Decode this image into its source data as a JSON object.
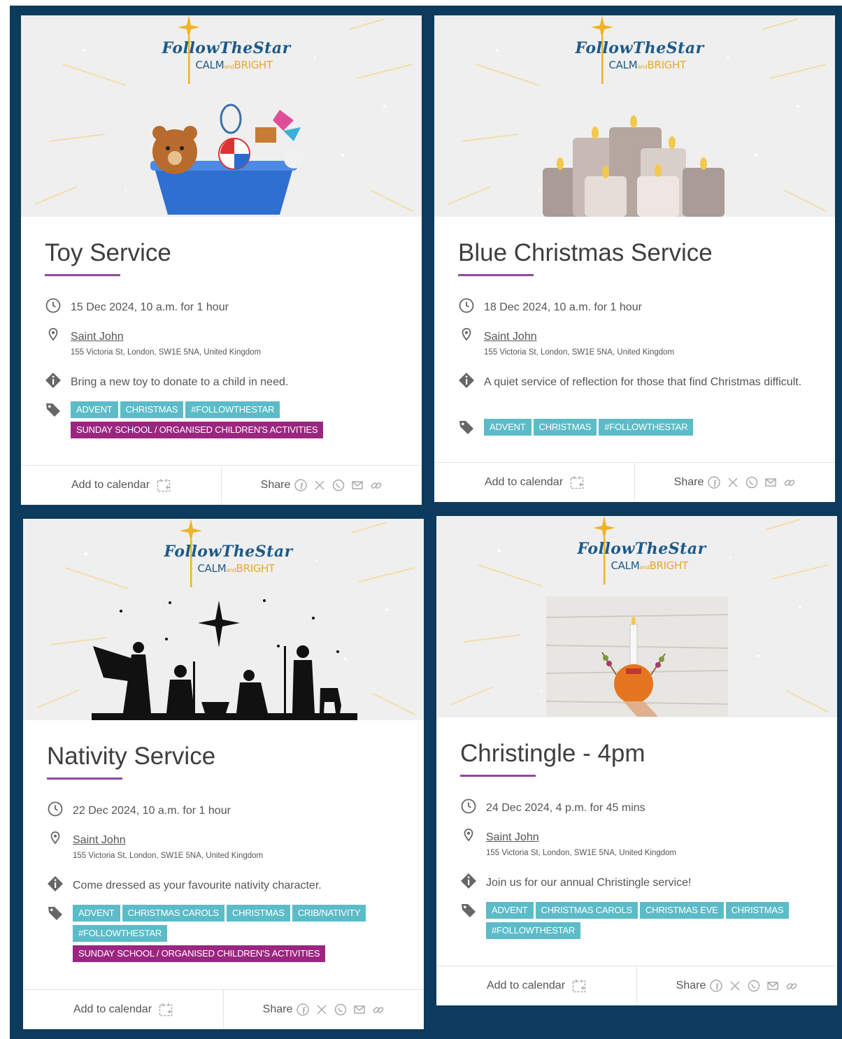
{
  "brand": {
    "logo_main": "FollowTheStar",
    "logo_sub_left": "CALM",
    "logo_sub_and": "and",
    "logo_sub_right": "BRIGHT"
  },
  "colors": {
    "background": "#0d3b5e",
    "accent_underline": "#8e4a9e",
    "tag_teal": "#5bbcc8",
    "tag_purple": "#9b2680"
  },
  "labels": {
    "add_to_calendar": "Add to calendar",
    "share": "Share"
  },
  "share_icons": [
    "facebook-icon",
    "x-icon",
    "whatsapp-icon",
    "email-icon",
    "link-icon"
  ],
  "events": [
    {
      "title": "Toy Service",
      "when": "15 Dec 2024, 10 a.m. for 1 hour",
      "venue": "Saint John",
      "address": "155 Victoria St, London, SW1E 5NA, United Kingdom",
      "description": "Bring a new toy to donate to a child in need.",
      "tags": [
        "ADVENT",
        "CHRISTMAS",
        "#FOLLOWTHESTAR"
      ],
      "tags_purple": [
        "SUNDAY SCHOOL / ORGANISED CHILDREN'S ACTIVITIES"
      ],
      "image": "toy-basket"
    },
    {
      "title": "Blue Christmas Service",
      "when": "18 Dec 2024, 10 a.m. for 1 hour",
      "venue": "Saint John",
      "address": "155 Victoria St, London, SW1E 5NA, United Kingdom",
      "description": "A quiet service of reflection for those that find Christmas difficult.",
      "tags": [
        "ADVENT",
        "CHRISTMAS",
        "#FOLLOWTHESTAR"
      ],
      "tags_purple": [],
      "image": "candles"
    },
    {
      "title": "Nativity Service",
      "when": "22 Dec 2024, 10 a.m. for 1 hour",
      "venue": "Saint John",
      "address": "155 Victoria St, London, SW1E 5NA, United Kingdom",
      "description": "Come dressed as your favourite nativity character.",
      "tags": [
        "ADVENT",
        "CHRISTMAS CAROLS",
        "CHRISTMAS",
        "CRIB/NATIVITY",
        "#FOLLOWTHESTAR"
      ],
      "tags_purple": [
        "SUNDAY SCHOOL / ORGANISED CHILDREN'S ACTIVITIES"
      ],
      "image": "nativity-silhouette"
    },
    {
      "title": "Christingle - 4pm",
      "when": "24 Dec 2024, 4 p.m. for 45 mins",
      "venue": "Saint John",
      "address": "155 Victoria St, London, SW1E 5NA, United Kingdom",
      "description": "Join us for our annual Christingle service!",
      "tags": [
        "ADVENT",
        "CHRISTMAS CAROLS",
        "CHRISTMAS EVE",
        "CHRISTMAS",
        "#FOLLOWTHESTAR"
      ],
      "tags_purple": [],
      "image": "christingle-photo"
    }
  ]
}
